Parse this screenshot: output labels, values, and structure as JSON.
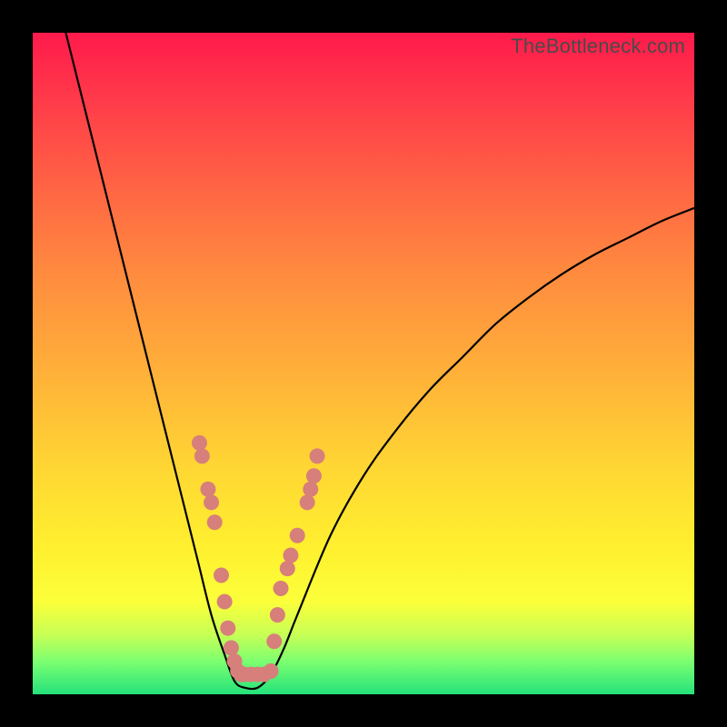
{
  "watermark": "TheBottleneck.com",
  "colors": {
    "background": "#000000",
    "gradient_top": "#ff1a4b",
    "gradient_bottom": "#24e27b",
    "curve": "#000000",
    "marker_fill": "#d77f7a",
    "marker_stroke": "#b85f58"
  },
  "chart_data": {
    "type": "line",
    "title": "",
    "xlabel": "",
    "ylabel": "",
    "xlim": [
      0,
      100
    ],
    "ylim": [
      0,
      100
    ],
    "grid": false,
    "legend": false,
    "series": [
      {
        "name": "bottleneck-curve",
        "x": [
          5,
          8,
          12,
          16,
          20,
          23,
          25,
          27,
          29,
          30.5,
          32,
          34,
          36,
          38,
          40,
          45,
          50,
          55,
          60,
          65,
          70,
          75,
          80,
          85,
          90,
          95,
          100
        ],
        "y": [
          100,
          88,
          72,
          56,
          40,
          28,
          20,
          12,
          6,
          2,
          1,
          1,
          3,
          7,
          12,
          24,
          33,
          40,
          46,
          51,
          56,
          60,
          63.5,
          66.5,
          69,
          71.5,
          73.5
        ]
      }
    ],
    "markers": [
      {
        "x": 25.2,
        "y": 38
      },
      {
        "x": 25.6,
        "y": 36
      },
      {
        "x": 26.5,
        "y": 31
      },
      {
        "x": 27.0,
        "y": 29
      },
      {
        "x": 27.5,
        "y": 26
      },
      {
        "x": 28.5,
        "y": 18
      },
      {
        "x": 29.0,
        "y": 14
      },
      {
        "x": 29.5,
        "y": 10
      },
      {
        "x": 30.0,
        "y": 7
      },
      {
        "x": 30.5,
        "y": 5
      },
      {
        "x": 31.0,
        "y": 3.5
      },
      {
        "x": 31.5,
        "y": 3
      },
      {
        "x": 32.0,
        "y": 3
      },
      {
        "x": 33.0,
        "y": 3
      },
      {
        "x": 34.0,
        "y": 3
      },
      {
        "x": 35.0,
        "y": 3
      },
      {
        "x": 36.0,
        "y": 3.5
      },
      {
        "x": 36.5,
        "y": 8
      },
      {
        "x": 37.0,
        "y": 12
      },
      {
        "x": 37.5,
        "y": 16
      },
      {
        "x": 38.5,
        "y": 19
      },
      {
        "x": 39.0,
        "y": 21
      },
      {
        "x": 40.0,
        "y": 24
      },
      {
        "x": 41.5,
        "y": 29
      },
      {
        "x": 42.0,
        "y": 31
      },
      {
        "x": 42.5,
        "y": 33
      },
      {
        "x": 43.0,
        "y": 36
      }
    ]
  }
}
